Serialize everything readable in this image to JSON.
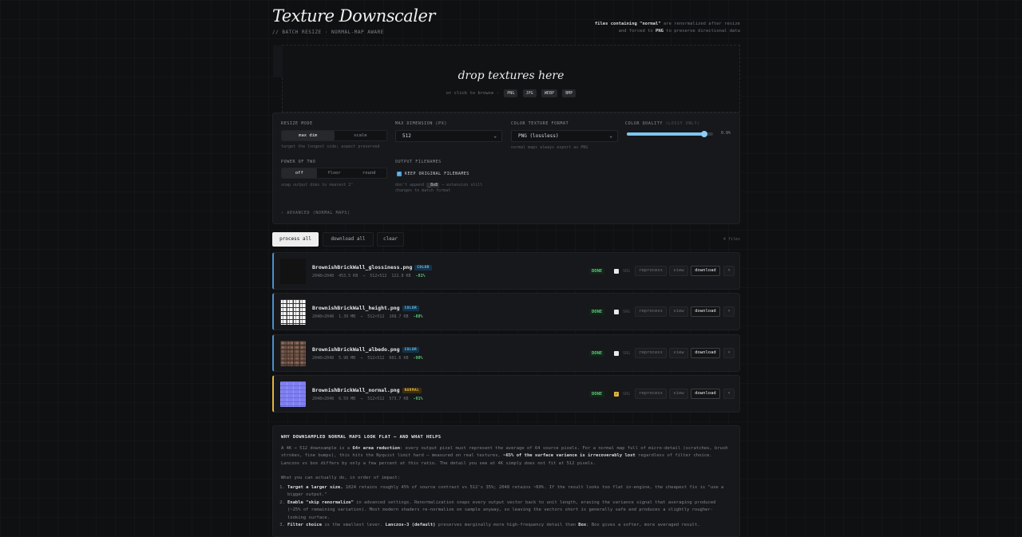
{
  "header": {
    "title": "Texture Downscaler",
    "subtitle": "// BATCH RESIZE · NORMAL-MAP AWARE",
    "note_pre": "files containing ",
    "note_normal": "\"normal\"",
    "note_mid": " are renormalized after resize",
    "note_line2_pre": "and forced to ",
    "note_png": "PNG",
    "note_line2_post": " to preserve directional data"
  },
  "dropzone": {
    "title": "drop textures here",
    "subtitle": "or click to browse ·",
    "formats": [
      "PNG",
      "JPG",
      "WEBP",
      "BMP"
    ]
  },
  "settings": {
    "resize_mode": {
      "label": "RESIZE MODE",
      "options": [
        "max dim",
        "scale"
      ],
      "selected": "max dim",
      "hint": "target the longest side; aspect preserved"
    },
    "max_dimension": {
      "label": "MAX DIMENSION (PX)",
      "value": "512"
    },
    "color_format": {
      "label": "COLOR TEXTURE FORMAT",
      "value": "PNG (lossless)",
      "hint": "normal maps always export as PNG"
    },
    "color_quality": {
      "label": "COLOR QUALITY",
      "label_dim": "(LOSSY ONLY)",
      "value_text": "0.9%",
      "fraction": 0.9
    },
    "power_of_two": {
      "label": "POWER OF TWO",
      "options": [
        "off",
        "floor",
        "round"
      ],
      "selected": "off",
      "hint": "snap output dims to nearest 2ⁿ"
    },
    "output_filenames": {
      "label": "OUTPUT FILENAMES",
      "checkbox_label": "KEEP ORIGINAL FILENAMES",
      "checked": true,
      "hint_pre": "don't append ",
      "hint_code": "_8x8",
      "hint_post": " — extension still",
      "hint_line2": "changes to match format"
    },
    "advanced": "› ADVANCED (NORMAL MAPS)"
  },
  "actions": {
    "process_all": "process all",
    "download_all": "download all",
    "clear": "clear",
    "count": "4 files"
  },
  "files": [
    {
      "name": "BrownishBrickWall_glossiness.png",
      "kind": "COLOR",
      "src_dims": "2048×2048",
      "src_size": "453.5 KB",
      "arrow": "→",
      "out_dims": "512×512",
      "out_size": "122.8 KB",
      "gain": "-81%",
      "status": "DONE",
      "srgb": "SRG",
      "srgb_checked": false,
      "reprocess": "reprocess",
      "view": "view",
      "download": "download",
      "remove": "×",
      "thumb": "gloss"
    },
    {
      "name": "BrownishBrickWall_height.png",
      "kind": "COLOR",
      "src_dims": "2048×2048",
      "src_size": "1.39 MB",
      "arrow": "→",
      "out_dims": "512×512",
      "out_size": "168.7 KB",
      "gain": "-88%",
      "status": "DONE",
      "srgb": "SRG",
      "srgb_checked": false,
      "reprocess": "reprocess",
      "view": "view",
      "download": "download",
      "remove": "×",
      "thumb": "height"
    },
    {
      "name": "BrownishBrickWall_albedo.png",
      "kind": "COLOR",
      "src_dims": "2048×2048",
      "src_size": "5.98 MB",
      "arrow": "→",
      "out_dims": "512×512",
      "out_size": "601.6 KB",
      "gain": "-90%",
      "status": "DONE",
      "srgb": "SRG",
      "srgb_checked": false,
      "reprocess": "reprocess",
      "view": "view",
      "download": "download",
      "remove": "×",
      "thumb": "albedo"
    },
    {
      "name": "BrownishBrickWall_normal.png",
      "kind": "NORMAL",
      "src_dims": "2048×2048",
      "src_size": "6.59 MB",
      "arrow": "→",
      "out_dims": "512×512",
      "out_size": "573.7 KB",
      "gain": "-91%",
      "status": "DONE",
      "srgb": "SRG",
      "srgb_checked": true,
      "reprocess": "reprocess",
      "view": "view",
      "download": "download",
      "remove": "×",
      "thumb": "normal"
    }
  ],
  "info": {
    "heading": "WHY DOWNSAMPLED NORMAL MAPS LOOK FLAT — AND WHAT HELPS",
    "p1_a": "A 4K → 512 downsample is a ",
    "p1_b": "64× area reduction",
    "p1_c": ": every output pixel must represent the average of 64 source pixels. For a normal map full of micro-detail (scratches, brush strokes, fine bumps), this hits the Nyquist limit hard — measured on real textures, ",
    "p1_d": "~65% of the surface variance is irrecoverably lost",
    "p1_e": " regardless of filter choice. Lanczos vs box differs by only a few percent at this ratio. The detail you see at 4K simply does not fit at 512 pixels.",
    "p2": "What you can actually do, in order of impact:",
    "li1_a": "Target a larger size.",
    "li1_b": " 1024 retains roughly 45% of source contrast vs 512's 35%; 2048 retains ~60%. If the result looks too flat in-engine, the cheapest fix is \"use a bigger output.\"",
    "li2_a": "Enable \"skip renormalize\"",
    "li2_b": " in advanced settings. Renormalization snaps every output vector back to unit length, erasing the variance signal that averaging produced (~25% of remaining variation). Most modern shaders re-normalize on sample anyway, so leaving the vectors short is generally safe and produces a slightly rougher-looking surface.",
    "li3_a": "Filter choice",
    "li3_b": " is the smallest lever. ",
    "li3_c": "Lanczos-3 (default)",
    "li3_d": " preserves marginally more high-frequency detail than ",
    "li3_e": "Box",
    "li3_f": "; Box gives a softer, more averaged result."
  },
  "colors": {
    "accent_blue": "#4c8fc9",
    "accent_normal": "#e3b341",
    "done_green": "#58c77a",
    "slider": "#7ec4f0"
  }
}
